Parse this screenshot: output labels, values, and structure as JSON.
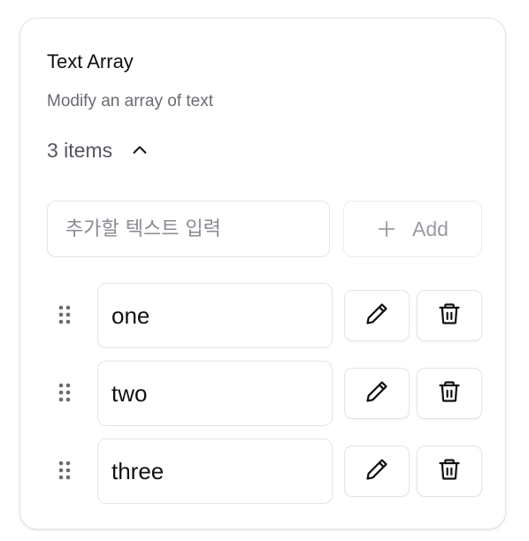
{
  "card": {
    "title": "Text Array",
    "subtitle": "Modify an array of text"
  },
  "list": {
    "count_label": "3 items",
    "toggle_icon": "chevron-up-icon",
    "expanded": true
  },
  "add_form": {
    "placeholder": "추가할 텍스트 입력",
    "value": "",
    "button_label": "Add",
    "button_icon": "plus-icon"
  },
  "items": [
    {
      "value": "one"
    },
    {
      "value": "two"
    },
    {
      "value": "three"
    }
  ],
  "item_actions": {
    "edit_icon": "pencil-icon",
    "delete_icon": "trash-icon",
    "drag_icon": "grip-vertical-icon"
  },
  "colors": {
    "text_primary": "#111111",
    "text_muted": "#6b6b73",
    "border": "#e4e4e7",
    "add_label": "#9a9aa2"
  }
}
